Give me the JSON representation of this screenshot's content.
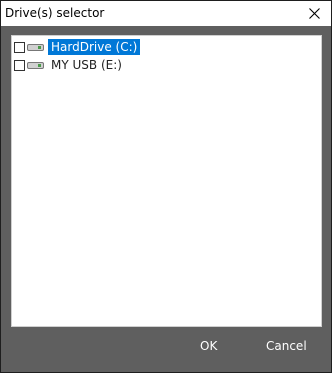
{
  "window": {
    "title": "Drive(s) selector"
  },
  "drives": [
    {
      "label": "HardDrive (C:)",
      "checked": false,
      "selected": true
    },
    {
      "label": "MY USB (E:)",
      "checked": false,
      "selected": false
    }
  ],
  "buttons": {
    "ok": "OK",
    "cancel": "Cancel"
  },
  "colors": {
    "selection": "#0078d7",
    "dialog_bg": "#5f5f5f"
  }
}
